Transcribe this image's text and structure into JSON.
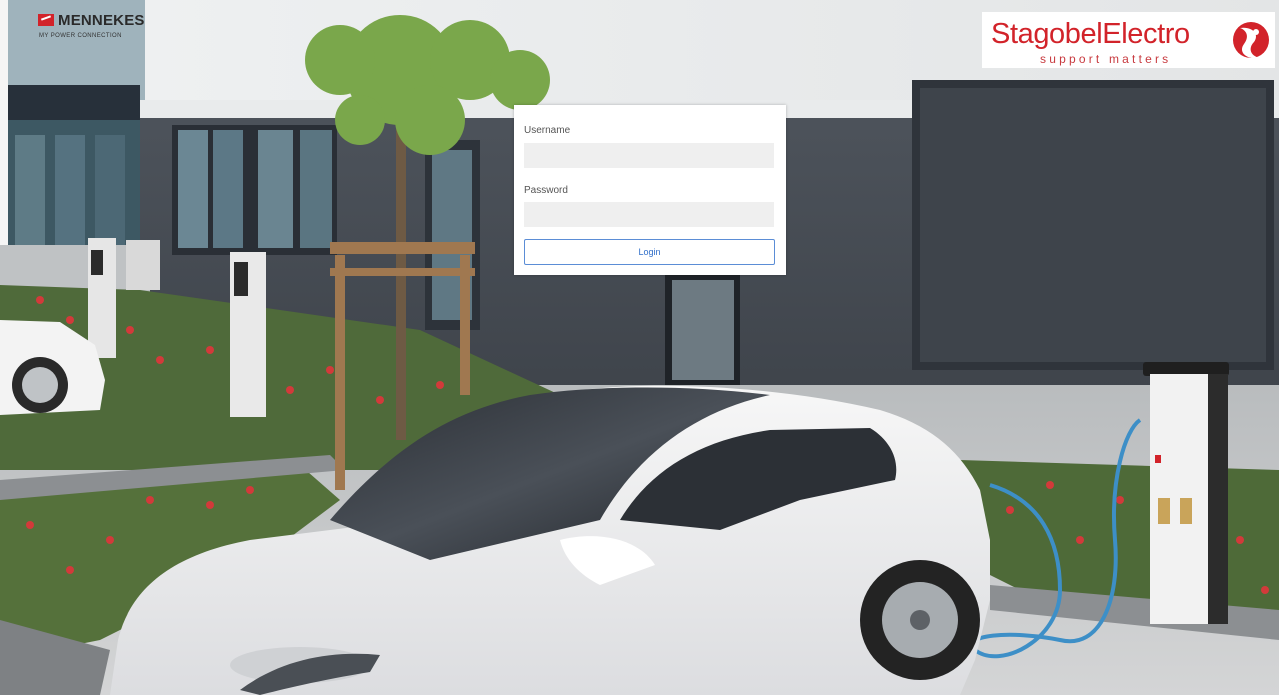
{
  "brand_left": {
    "name": "MENNEKES",
    "tagline": "MY POWER CONNECTION",
    "logo_color": "#d2232a"
  },
  "brand_right": {
    "name_bold": "Stagobel",
    "name_rest": "Electro",
    "tagline": "support matters",
    "logo_color": "#d2232a"
  },
  "login": {
    "username_label": "Username",
    "username_value": "",
    "password_label": "Password",
    "password_value": "",
    "submit_label": "Login",
    "accent_color": "#2f6ec9"
  },
  "charger_brand": "MENNEKES"
}
